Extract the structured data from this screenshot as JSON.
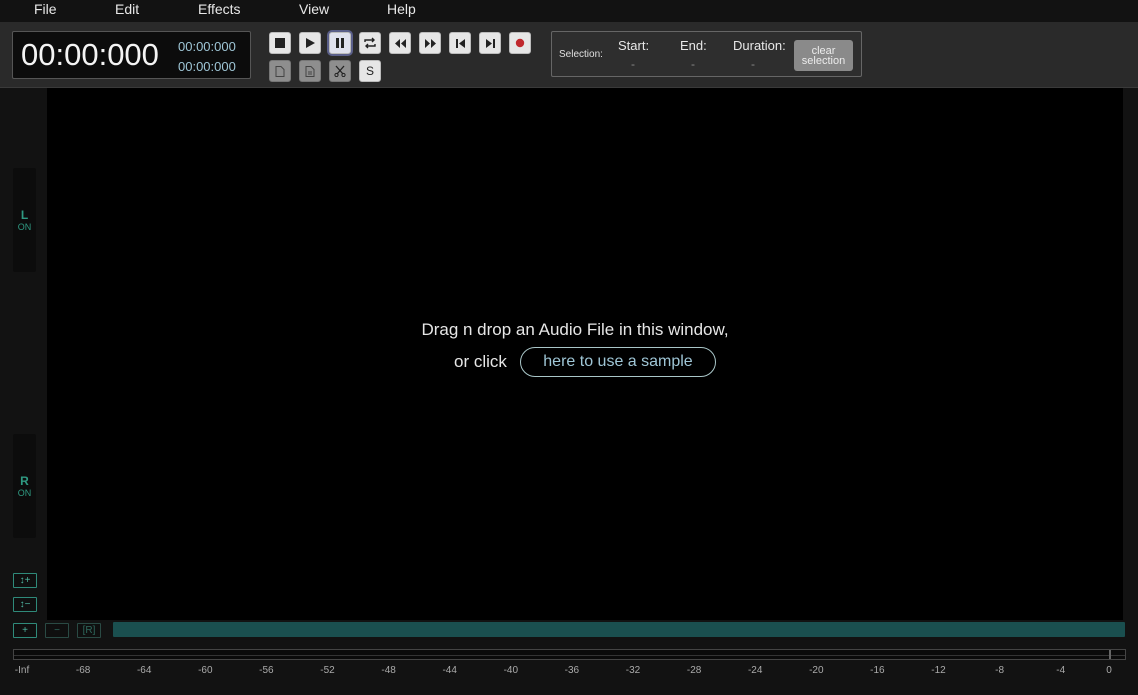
{
  "menu": {
    "items": [
      "File",
      "Edit",
      "Effects",
      "View",
      "Help"
    ]
  },
  "timer": {
    "main": "00:00:000",
    "sub1": "00:00:000",
    "sub2": "00:00:000"
  },
  "transport": {
    "icons": [
      "stop-icon",
      "play-icon",
      "pause-icon",
      "loop-icon",
      "rewind-icon",
      "fast-forward-icon",
      "skip-to-start-icon",
      "skip-to-end-icon",
      "record-icon"
    ],
    "edit_icons": [
      "copy-icon",
      "paste-icon",
      "cut-icon"
    ],
    "silence_label": "S"
  },
  "selection": {
    "label": "Selection:",
    "start_label": "Start:",
    "end_label": "End:",
    "duration_label": "Duration:",
    "start_value": "-",
    "end_value": "-",
    "duration_value": "-",
    "clear_line1": "clear",
    "clear_line2": "selection"
  },
  "channels": {
    "left": {
      "letter": "L",
      "state": "ON"
    },
    "right": {
      "letter": "R",
      "state": "ON"
    }
  },
  "dropzone": {
    "line1": "Drag n drop an Audio File in this window,",
    "or_click": "or click",
    "sample_button": "here to use a sample"
  },
  "zoom": {
    "v_zoom_in": "↕+",
    "v_zoom_out": "↕−",
    "h_zoom_in": "+",
    "h_zoom_out": "−",
    "reset": "[R]"
  },
  "meter": {
    "scale": [
      "-Inf",
      "-68",
      "-64",
      "-60",
      "-56",
      "-52",
      "-48",
      "-44",
      "-40",
      "-36",
      "-32",
      "-28",
      "-24",
      "-20",
      "-16",
      "-12",
      "-8",
      "-4",
      "0"
    ]
  },
  "colors": {
    "accent": "#2f9a82",
    "timer_sub": "#9fc6d6",
    "record": "#c0282d",
    "minimap": "#1a4f4f"
  }
}
